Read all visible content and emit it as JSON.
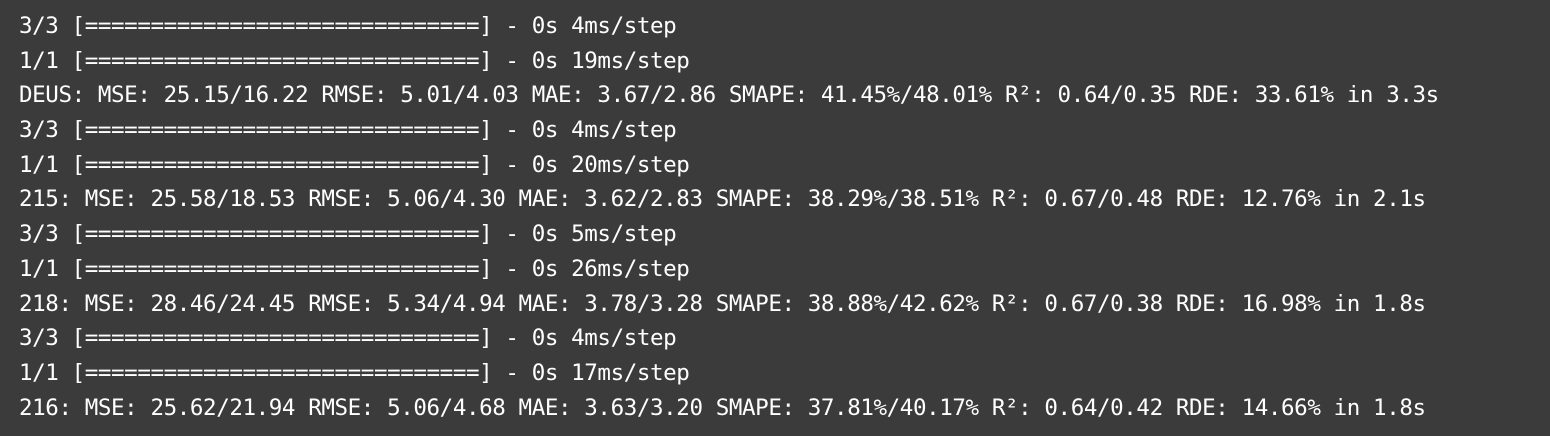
{
  "terminal": {
    "lines": [
      "3/3 [==============================] - 0s 4ms/step",
      "1/1 [==============================] - 0s 19ms/step",
      "DEUS: MSE: 25.15/16.22 RMSE: 5.01/4.03 MAE: 3.67/2.86 SMAPE: 41.45%/48.01% R²: 0.64/0.35 RDE: 33.61% in 3.3s",
      "3/3 [==============================] - 0s 4ms/step",
      "1/1 [==============================] - 0s 20ms/step",
      "215: MSE: 25.58/18.53 RMSE: 5.06/4.30 MAE: 3.62/2.83 SMAPE: 38.29%/38.51% R²: 0.67/0.48 RDE: 12.76% in 2.1s",
      "3/3 [==============================] - 0s 5ms/step",
      "1/1 [==============================] - 0s 26ms/step",
      "218: MSE: 28.46/24.45 RMSE: 5.34/4.94 MAE: 3.78/3.28 SMAPE: 38.88%/42.62% R²: 0.67/0.38 RDE: 16.98% in 1.8s",
      "3/3 [==============================] - 0s 4ms/step",
      "1/1 [==============================] - 0s 17ms/step",
      "216: MSE: 25.62/21.94 RMSE: 5.06/4.68 MAE: 3.63/3.20 SMAPE: 37.81%/40.17% R²: 0.64/0.42 RDE: 14.66% in 1.8s"
    ]
  },
  "colors": {
    "background": "#3b3b3b",
    "text": "#ffffff"
  }
}
